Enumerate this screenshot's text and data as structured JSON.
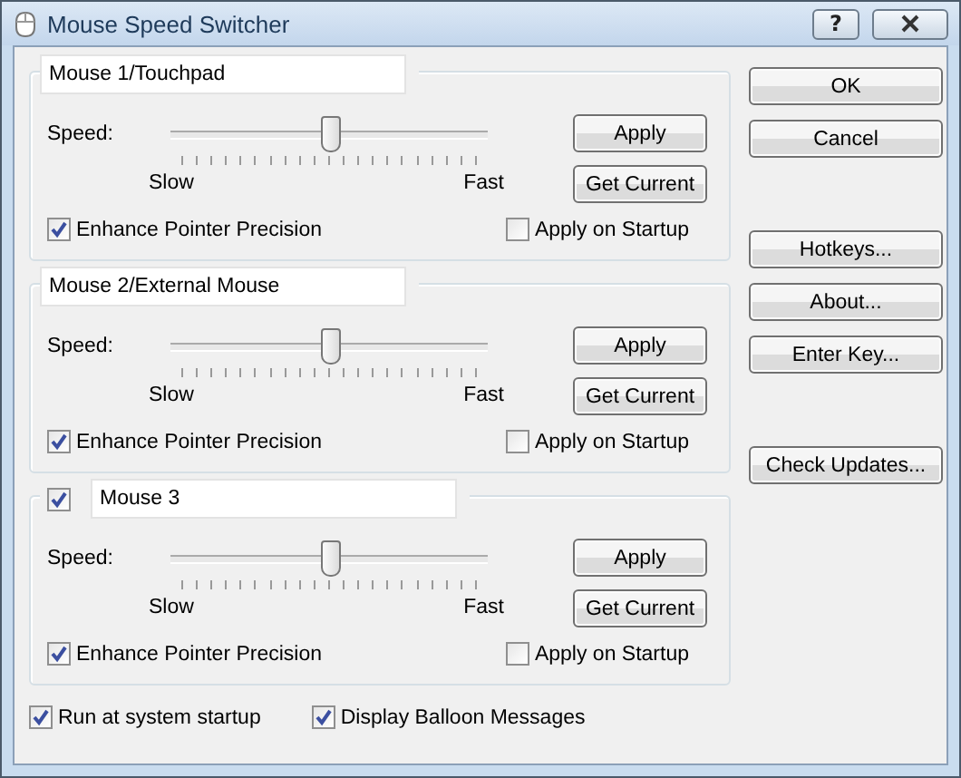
{
  "window": {
    "title": "Mouse Speed Switcher",
    "help": "?"
  },
  "mice": [
    {
      "kind": "fixed",
      "name": "Mouse 1/Touchpad",
      "speed_label": "Speed:",
      "slow": "Slow",
      "fast": "Fast",
      "level": 0.5,
      "apply": "Apply",
      "get_current": "Get Current",
      "enhance": {
        "label": "Enhance Pointer Precision",
        "checked": true
      },
      "startup": {
        "label": "Apply on Startup",
        "checked": false
      }
    },
    {
      "kind": "fixed",
      "name": "Mouse 2/External Mouse",
      "speed_label": "Speed:",
      "slow": "Slow",
      "fast": "Fast",
      "level": 0.5,
      "apply": "Apply",
      "get_current": "Get Current",
      "enhance": {
        "label": "Enhance Pointer Precision",
        "checked": true
      },
      "startup": {
        "label": "Apply on Startup",
        "checked": false
      }
    },
    {
      "kind": "toggle",
      "enabled": true,
      "name": "Mouse 3",
      "speed_label": "Speed:",
      "slow": "Slow",
      "fast": "Fast",
      "level": 0.5,
      "apply": "Apply",
      "get_current": "Get Current",
      "enhance": {
        "label": "Enhance Pointer Precision",
        "checked": true
      },
      "startup": {
        "label": "Apply on Startup",
        "checked": false
      }
    }
  ],
  "button_groups": [
    [
      "OK",
      "Cancel"
    ],
    [
      "Hotkeys...",
      "About...",
      "Enter Key..."
    ],
    [
      "Check Updates..."
    ]
  ],
  "options": [
    {
      "label": "Run at system startup",
      "checked": true
    },
    {
      "label": "Display Balloon Messages",
      "checked": true
    }
  ]
}
